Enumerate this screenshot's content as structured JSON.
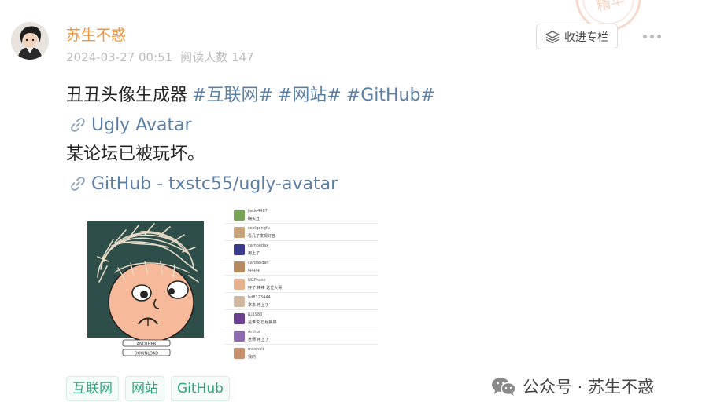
{
  "post": {
    "author": "苏生不惑",
    "date": "2024-03-27 00:51",
    "reads": "阅读人数 147",
    "collect_label": "收进专栏",
    "lines": {
      "line1_text": "丑丑头像生成器",
      "hashtags": [
        "#互联网#",
        "#网站#",
        "#GitHub#"
      ],
      "link1": "Ugly Avatar",
      "line3_text": "某论坛已被玩坏。",
      "link2": "GitHub - txstc55/ugly-avatar"
    },
    "images": [
      {
        "name": "avatar-generator-screenshot",
        "buttons": [
          "ANOTHER",
          "DOWNLOAD"
        ]
      },
      {
        "name": "forum-comments-screenshot",
        "comments": [
          {
            "user": "jiade4487",
            "text": "确实丑",
            "color": "#7aa35a"
          },
          {
            "user": "coolgongfu",
            "text": "看几了发现好丑",
            "color": "#c9a27a"
          },
          {
            "user": "campedax",
            "text": "用上了",
            "color": "#3a3a8c"
          },
          {
            "user": "cardandan",
            "text": "好好好",
            "color": "#b58a5e"
          },
          {
            "user": "NGPhase",
            "text": "好了 棒棒 这位大哥",
            "color": "#e4b08d"
          },
          {
            "user": "hd8123444",
            "text": "拿来 用上了",
            "color": "#d0b8a0"
          },
          {
            "user": "JLi1980",
            "text": "是谁说 已经换好",
            "color": "#6a3f8e"
          },
          {
            "user": "Arthur",
            "text": "老师 用上了",
            "color": "#8e6bb0"
          },
          {
            "user": "meeheli",
            "text": "我的",
            "color": "#c48f6a"
          }
        ]
      }
    ],
    "tags": [
      "互联网",
      "网站",
      "GitHub"
    ]
  },
  "watermark": {
    "text": "公众号 · 苏生不惑"
  },
  "colors": {
    "author": "#f2923a",
    "link": "#5b7fa3",
    "tag_text": "#2fa57c",
    "avatar_bg": "#2e4e4a",
    "face": "#f6b99a"
  }
}
